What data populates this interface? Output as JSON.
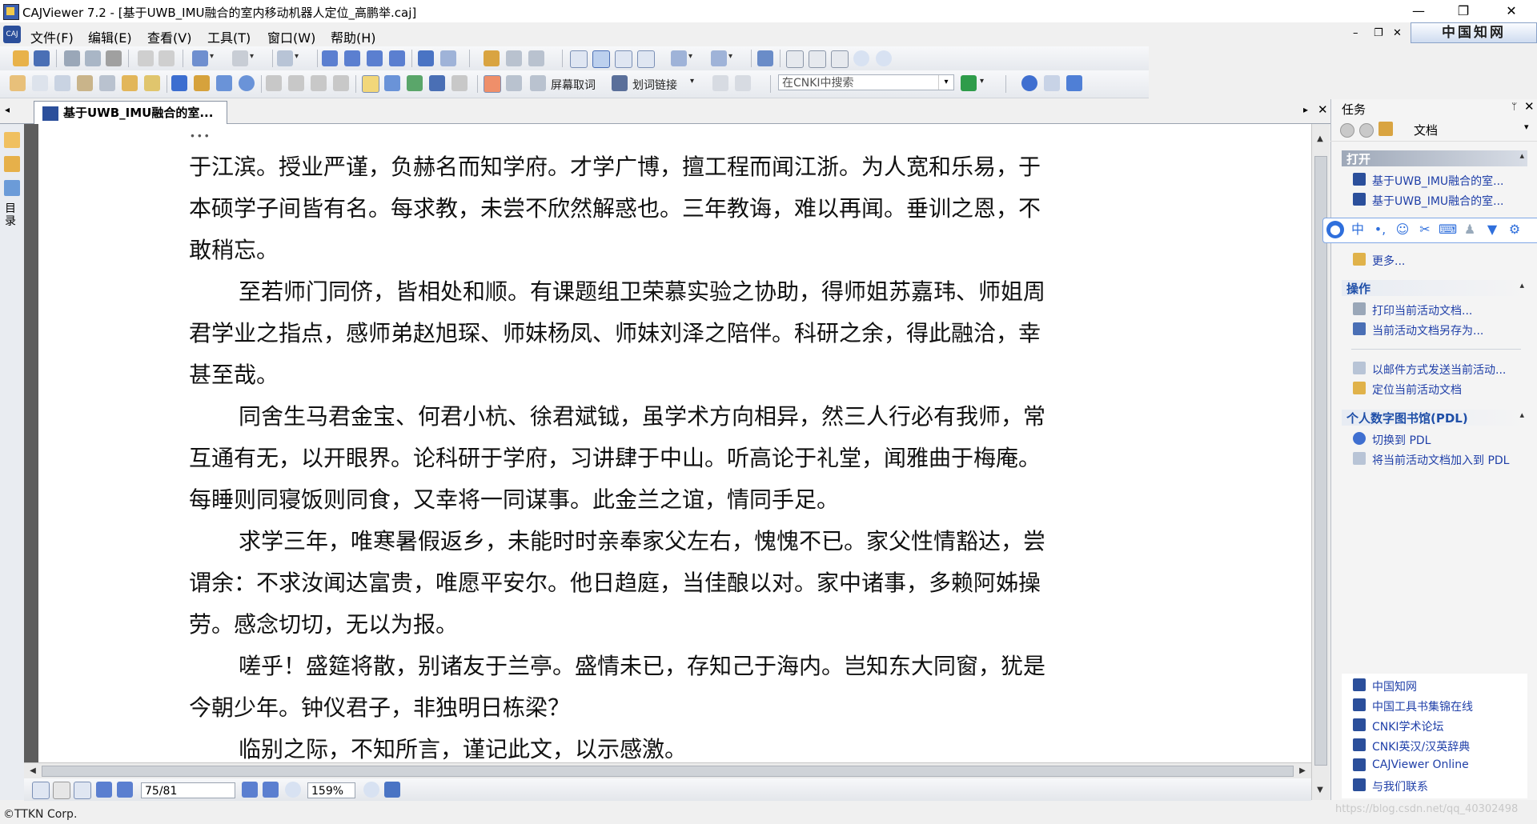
{
  "window": {
    "title": "CAJViewer 7.2 - [基于UWB_IMU融合的室内移动机器人定位_高鹏举.caj]",
    "controls": {
      "minimize": "—",
      "restore": "❐",
      "close": "✕"
    }
  },
  "menubar": {
    "items": [
      "文件(F)",
      "编辑(E)",
      "查看(V)",
      "工具(T)",
      "窗口(W)",
      "帮助(H)"
    ],
    "mdi_controls": {
      "minimize": "–",
      "restore": "❐",
      "close": "✕"
    },
    "brand": "中国知网"
  },
  "toolbar2": {
    "screen_capture": "屏幕取词",
    "word_link": "划词链接",
    "search_placeholder": "在CNKI中搜索"
  },
  "tab": {
    "label": "基于UWB_IMU融合的室..."
  },
  "left_strip": {
    "outline_label": "目录"
  },
  "document": {
    "lines": [
      "于江滨。授业严谨，负赫名而知学府。才学广博，擅工程而闻江浙。为人宽和乐易，于",
      "本硕学子间皆有名。每求教，未尝不欣然解惑也。三年教诲，难以再闻。垂训之恩，不",
      "敢稍忘。",
      "至若师门同侪，皆相处和顺。有课题组卫荣慕实验之协助，得师姐苏嘉玮、师姐周",
      "君学业之指点，感师弟赵旭琛、师妹杨凤、师妹刘泽之陪伴。科研之余，得此融洽，幸",
      "甚至哉。",
      "同舍生马君金宝、何君小杭、徐君斌钺，虽学术方向相异，然三人行必有我师，常",
      "互通有无，以开眼界。论科研于学府，习讲肆于中山。听高论于礼堂，闻雅曲于梅庵。",
      "每睡则同寝饭则同食，又幸将一同谋事。此金兰之谊，情同手足。",
      "求学三年，唯寒暑假返乡，未能时时亲奉家父左右，愧愧不已。家父性情豁达，尝",
      "谓余：不求汝闻达富贵，唯愿平安尔。他日趋庭，当佳酿以对。家中诸事，多赖阿姊操",
      "劳。感念切切，无以为报。",
      "嗟乎！盛筵将散，别诸友于兰亭。盛情未已，存知己于海内。岂知东大同窗，犹是",
      "今朝少年。钟仪君子，非独明日栋梁？",
      "临别之际，不知所言，谨记此文，以示感激。"
    ]
  },
  "navigation": {
    "page": "75/81",
    "zoom": "159%"
  },
  "status": {
    "copyright": "©TTKN Corp."
  },
  "task_pane": {
    "title": "任务",
    "pin": "ᛘ",
    "close": "✕",
    "nav_label": "文档",
    "open_section": {
      "title": "打开",
      "items": [
        "基于UWB_IMU融合的室...",
        "基于UWB_IMU融合的室...",
        "更多..."
      ]
    },
    "ops_section": {
      "title": "操作",
      "items": [
        "打印当前活动文档...",
        "当前活动文档另存为...",
        "以邮件方式发送当前活动...",
        "定位当前活动文档"
      ]
    },
    "pdl_section": {
      "title": "个人数字图书馆(PDL)",
      "items": [
        "切换到 PDL",
        "将当前活动文档加入到 PDL"
      ]
    },
    "links": [
      "中国知网",
      "中国工具书集锦在线",
      "CNKI学术论坛",
      "CNKI英汉/汉英辞典",
      "CAJViewer Online",
      "与我们联系"
    ]
  },
  "ime_toolbar": {
    "mode": "中"
  },
  "watermark": "https://blog.csdn.net/qq_40302498"
}
